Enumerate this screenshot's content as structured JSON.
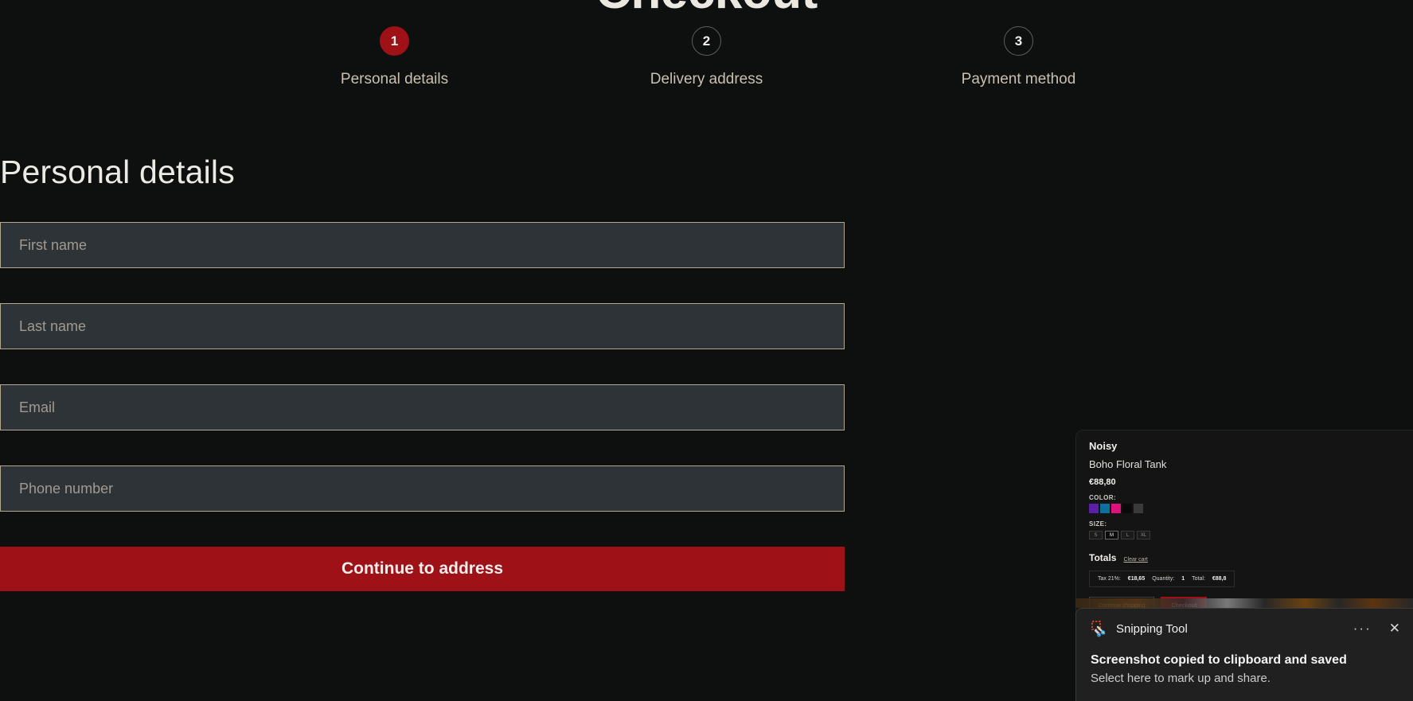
{
  "page": {
    "title": "Checkout",
    "section_title": "Personal details",
    "background": "#0e0f0f",
    "accent": "#9e1116",
    "border_accent": "#b4a78f"
  },
  "stepper": {
    "steps": [
      {
        "number": "1",
        "label": "Personal details",
        "active": true
      },
      {
        "number": "2",
        "label": "Delivery address",
        "active": false
      },
      {
        "number": "3",
        "label": "Payment method",
        "active": false
      }
    ]
  },
  "form": {
    "fields": [
      {
        "name": "first-name",
        "placeholder": "First name",
        "value": ""
      },
      {
        "name": "last-name",
        "placeholder": "Last name",
        "value": ""
      },
      {
        "name": "email",
        "placeholder": "Email",
        "value": ""
      },
      {
        "name": "phone",
        "placeholder": "Phone number",
        "value": ""
      }
    ],
    "submit_label": "Continue to address"
  },
  "cart": {
    "brand": "Noisy",
    "product_name": "Boho Floral Tank",
    "price": "€88,80",
    "color_label": "COLOR:",
    "colors": [
      "#5b1fa8",
      "#0d6f9e",
      "#e0107d",
      "#0a0a0a",
      "#3a3a3a"
    ],
    "size_label": "SIZE:",
    "sizes": [
      "S",
      "M",
      "L",
      "XL"
    ],
    "selected_size": "M",
    "totals_label": "Totals",
    "clear_cart_label": "Clear cart",
    "tax_label": "Tax 21%:",
    "tax_value": "€18,65",
    "quantity_label": "Quantity:",
    "quantity_value": "1",
    "total_label": "Total:",
    "total_value": "€88,8",
    "continue_shopping_label": "Continue shopping",
    "checkout_label": "Checkout",
    "qty_increase": "+",
    "qty_current": "1",
    "qty_decrease": "-"
  },
  "toast": {
    "app_name": "Snipping Tool",
    "more_glyph": "···",
    "close_glyph": "✕",
    "title": "Screenshot copied to clipboard and saved",
    "subtitle": "Select here to mark up and share."
  }
}
